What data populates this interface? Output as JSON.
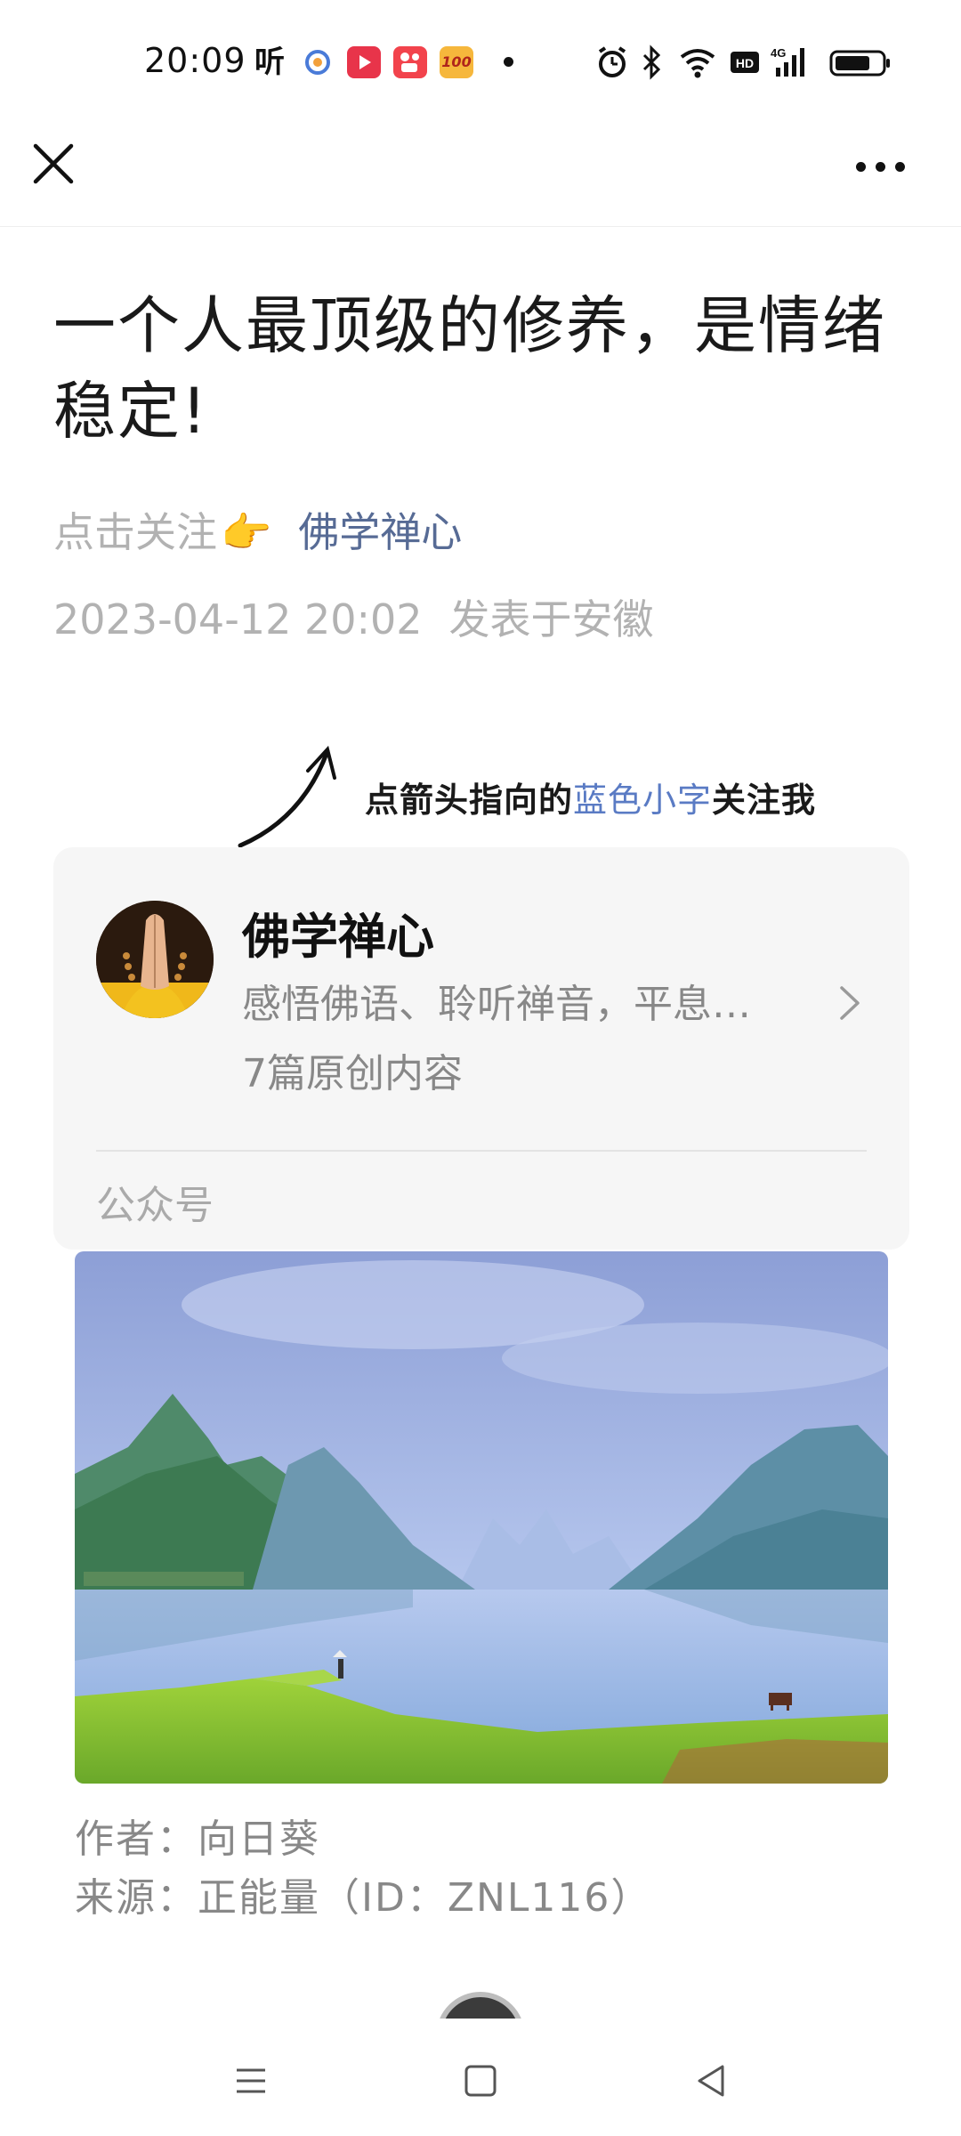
{
  "status_bar": {
    "time": "20:09",
    "app_ting": "听",
    "app_100": "100",
    "right_icons": [
      "alarm-icon",
      "bluetooth-icon",
      "wifi-icon",
      "hd-icon",
      "4g-signal-icon",
      "battery-icon"
    ]
  },
  "nav": {
    "close_icon": "close-icon",
    "more_icon": "more-icon"
  },
  "article": {
    "title": "一个人最顶级的修养，是情绪稳定!",
    "follow_prompt": "点击关注",
    "hand_emoji": "👉",
    "account_link": "佛学禅心",
    "datetime": "2023-04-12 20:02",
    "location": "发表于安徽"
  },
  "banner": {
    "text_before": "点箭头指向的",
    "text_blue": "蓝色小字",
    "text_after": "关注我"
  },
  "account_card": {
    "name": "佛学禅心",
    "description": "感悟佛语、聆听禅音，平息…",
    "original_count": "7篇原创内容",
    "type_label": "公众号"
  },
  "credits": {
    "author": "作者：向日葵",
    "source": "来源：正能量（ID：ZNL116）"
  },
  "colors": {
    "link_blue": "#576b95",
    "banner_blue": "#5a7bc4",
    "meta_gray": "#b2b2b2",
    "card_bg": "#f6f6f6"
  },
  "system_nav": [
    "menu-icon",
    "home-icon",
    "back-icon"
  ]
}
